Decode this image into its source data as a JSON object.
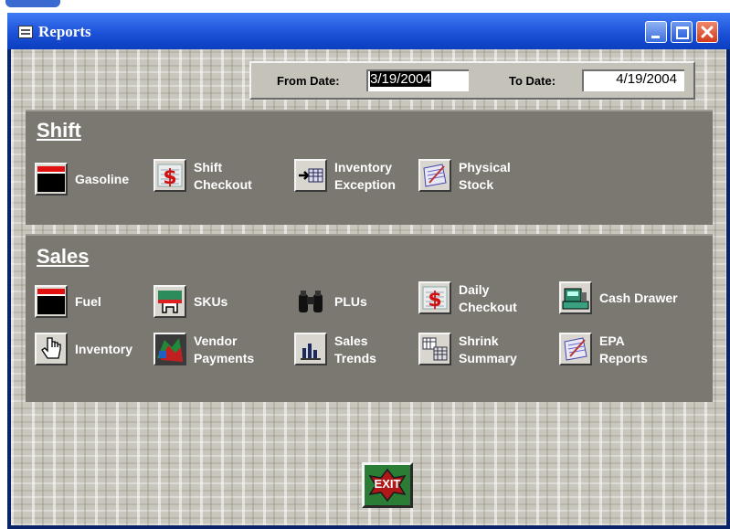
{
  "window": {
    "title": "Reports"
  },
  "dates": {
    "from_label": "From Date:",
    "from_value": "3/19/2004",
    "to_label": "To Date:",
    "to_value": "4/19/2004"
  },
  "shift": {
    "title": "Shift",
    "items": [
      {
        "line1": "Gasoline",
        "line2": "",
        "icon": "gasoline-icon"
      },
      {
        "line1": "Shift",
        "line2": "Checkout",
        "icon": "checkout-dollar-icon"
      },
      {
        "line1": "Inventory",
        "line2": "Exception",
        "icon": "inventory-exception-icon"
      },
      {
        "line1": "Physical",
        "line2": "Stock",
        "icon": "physical-stock-icon"
      }
    ]
  },
  "sales": {
    "title": "Sales",
    "items": [
      {
        "line1": "Fuel",
        "line2": "",
        "icon": "fuel-icon"
      },
      {
        "line1": "SKUs",
        "line2": "",
        "icon": "skus-icon"
      },
      {
        "line1": "PLUs",
        "line2": "",
        "icon": "binoculars-icon"
      },
      {
        "line1": "Daily",
        "line2": "Checkout",
        "icon": "daily-checkout-dollar-icon"
      },
      {
        "line1": "Cash Drawer",
        "line2": "",
        "icon": "cash-drawer-icon"
      },
      {
        "line1": "Inventory",
        "line2": "",
        "icon": "hand-pointer-icon"
      },
      {
        "line1": "Vendor",
        "line2": "Payments",
        "icon": "vendor-payments-icon"
      },
      {
        "line1": "Sales",
        "line2": "Trends",
        "icon": "bar-chart-icon"
      },
      {
        "line1": "Shrink",
        "line2": "Summary",
        "icon": "shrink-summary-icon"
      },
      {
        "line1": "EPA",
        "line2": "Reports",
        "icon": "epa-reports-icon"
      }
    ]
  },
  "exit": {
    "label": "EXIT",
    "icon": "exit-icon"
  }
}
